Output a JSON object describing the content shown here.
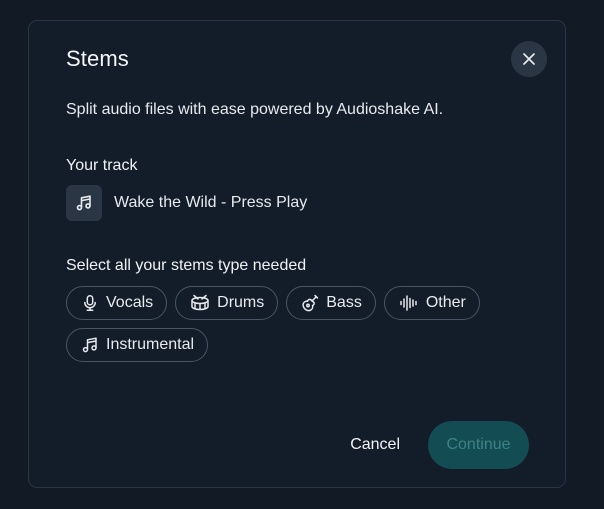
{
  "dialog": {
    "title": "Stems",
    "subtitle": "Split audio files with ease powered by Audioshake AI."
  },
  "track": {
    "label": "Your track",
    "name": "Wake the Wild - Press Play",
    "icon": "music-note-icon"
  },
  "stems": {
    "label": "Select all your stems type needed",
    "options": [
      {
        "label": "Vocals",
        "icon": "microphone-icon"
      },
      {
        "label": "Drums",
        "icon": "drum-icon"
      },
      {
        "label": "Bass",
        "icon": "guitar-icon"
      },
      {
        "label": "Other",
        "icon": "waveform-icon"
      },
      {
        "label": "Instrumental",
        "icon": "music-note-icon"
      }
    ]
  },
  "footer": {
    "cancel_label": "Cancel",
    "continue_label": "Continue"
  },
  "colors": {
    "background": "#111a25",
    "dialog": "#131d29",
    "continue_bg": "#134c53",
    "continue_text": "#3f8087"
  }
}
